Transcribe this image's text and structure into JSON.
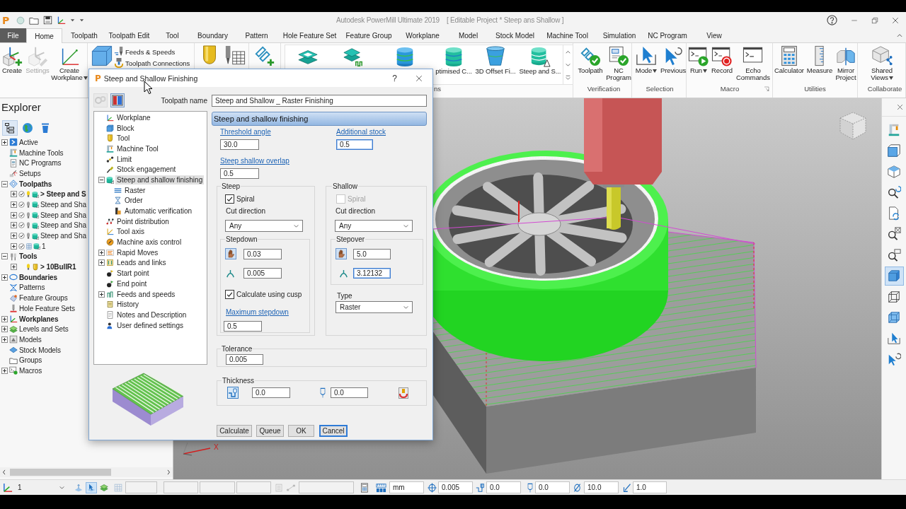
{
  "title_bar": {
    "logo": "P",
    "title": "Autodesk PowerMill Ultimate 2019",
    "project": "[ Editable Project * Steep ans Shallow ]"
  },
  "ribbon": {
    "tabs": [
      {
        "label": "File",
        "kind": "file",
        "selected": false
      },
      {
        "label": "Home",
        "kind": "tab",
        "selected": true
      },
      {
        "label": "Toolpath",
        "kind": "tab",
        "selected": false
      },
      {
        "label": "Toolpath Edit",
        "kind": "tab",
        "selected": false
      },
      {
        "label": "Tool",
        "kind": "tab",
        "selected": false
      },
      {
        "label": "Boundary",
        "kind": "tab",
        "selected": false
      },
      {
        "label": "Pattern",
        "kind": "tab",
        "selected": false
      },
      {
        "label": "Hole Feature Set",
        "kind": "tab",
        "selected": false
      },
      {
        "label": "Feature Group",
        "kind": "tab",
        "selected": false
      },
      {
        "label": "Workplane",
        "kind": "tab",
        "selected": false
      },
      {
        "label": "Model",
        "kind": "tab",
        "selected": false
      },
      {
        "label": "Stock Model",
        "kind": "tab",
        "selected": false
      },
      {
        "label": "Machine Tool",
        "kind": "tab",
        "selected": false
      },
      {
        "label": "Simulation",
        "kind": "tab",
        "selected": false
      },
      {
        "label": "NC Program",
        "kind": "tab",
        "selected": false
      },
      {
        "label": "View",
        "kind": "tab",
        "selected": false
      }
    ],
    "groups": [
      {
        "kind": "plain",
        "items": [
          {
            "kind": "large",
            "label": "Create",
            "menu": false,
            "disabled": false
          },
          {
            "kind": "large",
            "label": "Settings",
            "menu": false,
            "disabled": true
          },
          {
            "kind": "large",
            "label": "Create Workplane",
            "menu": true,
            "disabled": false
          }
        ]
      },
      {
        "kind": "plain",
        "items": [
          {
            "kind": "icon"
          },
          {
            "kind": "small",
            "label": "Feeds & Speeds"
          },
          {
            "kind": "small",
            "label": "Toolpath Connections"
          }
        ]
      },
      {
        "kind": "plain",
        "items": [
          {
            "kind": "icon"
          },
          {
            "kind": "icon"
          }
        ]
      },
      {
        "kind": "plain",
        "items": [
          {
            "kind": "icon"
          }
        ]
      },
      {
        "kind": "gallery",
        "label": "ns",
        "launcher": false,
        "items": [
          {
            "kind": "icon"
          },
          {
            "kind": "icon"
          },
          {
            "kind": "icon"
          },
          {
            "kind": "large",
            "label": "ptimised C...",
            "menu": false
          },
          {
            "kind": "large",
            "label": "3D Offset Fi...",
            "menu": false
          },
          {
            "kind": "large",
            "label": "Steep and S...",
            "menu": false
          }
        ]
      },
      {
        "kind": "plain",
        "label": "Verification",
        "launcher": false,
        "items": [
          {
            "kind": "large",
            "label": "Toolpath",
            "menu": false
          },
          {
            "kind": "large",
            "label": "NC Program",
            "menu": false
          }
        ]
      },
      {
        "kind": "plain",
        "label": "Selection",
        "launcher": false,
        "items": [
          {
            "kind": "large",
            "label": "Mode",
            "menu": true
          },
          {
            "kind": "large",
            "label": "Previous",
            "menu": false
          }
        ]
      },
      {
        "kind": "plain",
        "label": "Macro",
        "launcher": true,
        "items": [
          {
            "kind": "large",
            "label": "Run",
            "menu": true
          },
          {
            "kind": "large",
            "label": "Record",
            "menu": false
          },
          {
            "kind": "large",
            "label": "Echo Commands",
            "menu": false
          }
        ]
      },
      {
        "kind": "plain",
        "label": "Utilities",
        "launcher": false,
        "items": [
          {
            "kind": "large",
            "label": "Calculator",
            "menu": false
          },
          {
            "kind": "large",
            "label": "Measure",
            "menu": false
          },
          {
            "kind": "large",
            "label": "Mirror Project",
            "menu": false
          }
        ]
      },
      {
        "kind": "plain",
        "label": "Collaborate",
        "launcher": false,
        "items": [
          {
            "kind": "large",
            "label": "Shared Views",
            "menu": true
          }
        ]
      }
    ]
  },
  "explorer": {
    "title": "Explorer",
    "tabs": [
      {
        "selected": true
      },
      {
        "selected": false
      },
      {
        "selected": false
      }
    ],
    "tree": [
      {
        "label": "Active",
        "bold": false,
        "expandable": true,
        "expanded": false
      },
      {
        "label": "Machine Tools",
        "bold": false,
        "expandable": false,
        "expanded": false
      },
      {
        "label": "NC Programs",
        "bold": false,
        "expandable": false,
        "expanded": false
      },
      {
        "label": "Setups",
        "bold": false,
        "expandable": false,
        "expanded": false
      },
      {
        "label": "Toolpaths",
        "bold": true,
        "expandable": true,
        "expanded": true,
        "children": [
          {
            "label": "> Steep and S",
            "bold": true,
            "kind": "toolpath",
            "lit": true,
            "expandable": true,
            "expanded": false
          },
          {
            "label": "Steep and Sha",
            "bold": false,
            "kind": "toolpath",
            "lit": false,
            "expandable": true,
            "expanded": false
          },
          {
            "label": "Steep and Sha",
            "bold": false,
            "kind": "toolpath",
            "lit": false,
            "expandable": true,
            "expanded": false
          },
          {
            "label": "Steep and Sha",
            "bold": false,
            "kind": "toolpath",
            "lit": false,
            "expandable": true,
            "expanded": false
          },
          {
            "label": "Steep and Sha",
            "bold": false,
            "kind": "toolpath",
            "lit": false,
            "expandable": true,
            "expanded": false
          },
          {
            "label": "1",
            "bold": false,
            "kind": "queued",
            "expandable": true,
            "expanded": false
          }
        ]
      },
      {
        "label": "Tools",
        "bold": true,
        "expandable": true,
        "expanded": true,
        "children": [
          {
            "label": "> 10BullR1",
            "bold": true,
            "kind": "tool",
            "lit": true,
            "expandable": true,
            "expanded": false
          }
        ]
      },
      {
        "label": "Boundaries",
        "bold": true,
        "expandable": true,
        "expanded": false
      },
      {
        "label": "Patterns",
        "bold": false,
        "expandable": false,
        "expanded": false
      },
      {
        "label": "Feature Groups",
        "bold": false,
        "expandable": false,
        "expanded": false
      },
      {
        "label": "Hole Feature Sets",
        "bold": false,
        "expandable": false,
        "expanded": false
      },
      {
        "label": "Workplanes",
        "bold": true,
        "expandable": true,
        "expanded": false
      },
      {
        "label": "Levels and Sets",
        "bold": false,
        "expandable": true,
        "expanded": false
      },
      {
        "label": "Models",
        "bold": false,
        "expandable": true,
        "expanded": false
      },
      {
        "label": "Stock Models",
        "bold": false,
        "expandable": false,
        "expanded": false
      },
      {
        "label": "Groups",
        "bold": false,
        "expandable": false,
        "expanded": false
      },
      {
        "label": "Macros",
        "bold": false,
        "expandable": true,
        "expanded": false
      }
    ]
  },
  "dialog": {
    "logo": "P",
    "title": "Steep and Shallow Finishing",
    "help": "?",
    "toolbar": [
      {
        "disabled": true
      },
      {
        "disabled": false
      }
    ],
    "name_label": "Toolpath name",
    "name_value": "Steep and Shallow _ Raster Finishing",
    "tree": [
      {
        "label": "Workplane",
        "selected": false,
        "expandable": false,
        "expanded": false
      },
      {
        "label": "Block",
        "selected": false,
        "expandable": false,
        "expanded": false
      },
      {
        "label": "Tool",
        "selected": false,
        "expandable": false,
        "expanded": false
      },
      {
        "label": "Machine Tool",
        "selected": false,
        "expandable": false,
        "expanded": false
      },
      {
        "label": "Limit",
        "selected": false,
        "expandable": false,
        "expanded": false
      },
      {
        "label": "Stock engagement",
        "selected": false,
        "expandable": false,
        "expanded": false
      },
      {
        "label": "Steep and shallow finishing",
        "selected": true,
        "expandable": true,
        "expanded": true,
        "children": [
          {
            "label": "Raster",
            "selected": false,
            "expandable": false,
            "expanded": false
          },
          {
            "label": "Order",
            "selected": false,
            "expandable": false,
            "expanded": false
          },
          {
            "label": "Automatic verification",
            "selected": false,
            "expandable": false,
            "expanded": false
          }
        ]
      },
      {
        "label": "Point distribution",
        "selected": false,
        "expandable": false,
        "expanded": false
      },
      {
        "label": "Tool axis",
        "selected": false,
        "expandable": false,
        "expanded": false
      },
      {
        "label": "Machine axis control",
        "selected": false,
        "expandable": false,
        "expanded": false
      },
      {
        "label": "Rapid Moves",
        "selected": false,
        "expandable": true,
        "expanded": false
      },
      {
        "label": "Leads and links",
        "selected": false,
        "expandable": true,
        "expanded": false
      },
      {
        "label": "Start point",
        "selected": false,
        "expandable": false,
        "expanded": false
      },
      {
        "label": "End point",
        "selected": false,
        "expandable": false,
        "expanded": false
      },
      {
        "label": "Feeds and speeds",
        "selected": false,
        "expandable": true,
        "expanded": false
      },
      {
        "label": "History",
        "selected": false,
        "expandable": false,
        "expanded": false
      },
      {
        "label": "Notes and Description",
        "selected": false,
        "expandable": false,
        "expanded": false
      },
      {
        "label": "User defined settings",
        "selected": false,
        "expandable": false,
        "expanded": false
      }
    ],
    "header": "Steep and shallow finishing",
    "threshold_angle": {
      "label": "Threshold angle",
      "value": "30.0",
      "focused": false
    },
    "additional_stock": {
      "label": "Additional stock",
      "value": "0.5",
      "focused": true
    },
    "overlap": {
      "label": "Steep shallow overlap",
      "value": "0.5",
      "focused": false
    },
    "steep": {
      "title": "Steep",
      "spiral": {
        "label": "Spiral",
        "checked": true,
        "disabled": false
      },
      "cut_direction_label": "Cut direction",
      "cut_direction": "Any",
      "stepdown": {
        "title": "Stepdown",
        "fields": [
          {
            "value": "0.03",
            "focused": false
          },
          {
            "value": "0.005",
            "focused": false
          }
        ]
      },
      "cusp_option": {
        "label": "Calculate using cusp",
        "checked": true
      },
      "max_stepdown": {
        "label": "Maximum stepdown",
        "value": "0.5",
        "focused": false
      }
    },
    "shallow": {
      "title": "Shallow",
      "spiral": {
        "label": "Spiral",
        "checked": false,
        "disabled": true
      },
      "cut_direction_label": "Cut direction",
      "cut_direction": "Any",
      "stepover": {
        "title": "Stepover",
        "fields": [
          {
            "value": "5.0",
            "focused": false
          },
          {
            "value": "3.12132",
            "focused": true
          }
        ]
      },
      "type_label": "Type",
      "type": "Raster"
    },
    "tolerance": {
      "title": "Tolerance",
      "value": "0.005",
      "focused": false
    },
    "thickness": {
      "title": "Thickness",
      "fields": [
        {
          "value": "0.0",
          "focused": false
        },
        {
          "value": "0.0",
          "focused": false
        }
      ]
    },
    "buttons": [
      {
        "label": "Calculate",
        "focused": false
      },
      {
        "label": "Queue",
        "focused": false
      },
      {
        "label": "OK",
        "focused": false
      },
      {
        "label": "Cancel",
        "focused": true
      }
    ]
  },
  "viewport": {
    "axis_label": "X"
  },
  "side_toolbar": {
    "tools": [
      {
        "selected": false
      },
      {
        "selected": false
      },
      {
        "selected": false
      },
      {
        "selected": false
      },
      {
        "selected": false
      },
      {
        "selected": false
      },
      {
        "selected": false
      },
      {
        "selected": true
      },
      {
        "selected": false
      },
      {
        "selected": false
      },
      {
        "selected": false
      },
      {
        "selected": false
      }
    ]
  },
  "status_bar": {
    "workplane": "1",
    "toggles": [
      {
        "selected": false
      },
      {
        "selected": true
      },
      {
        "selected": false
      }
    ],
    "fields": [
      "mm",
      "0.005",
      "0.0",
      "0.0",
      "10.0",
      "1.0"
    ]
  }
}
